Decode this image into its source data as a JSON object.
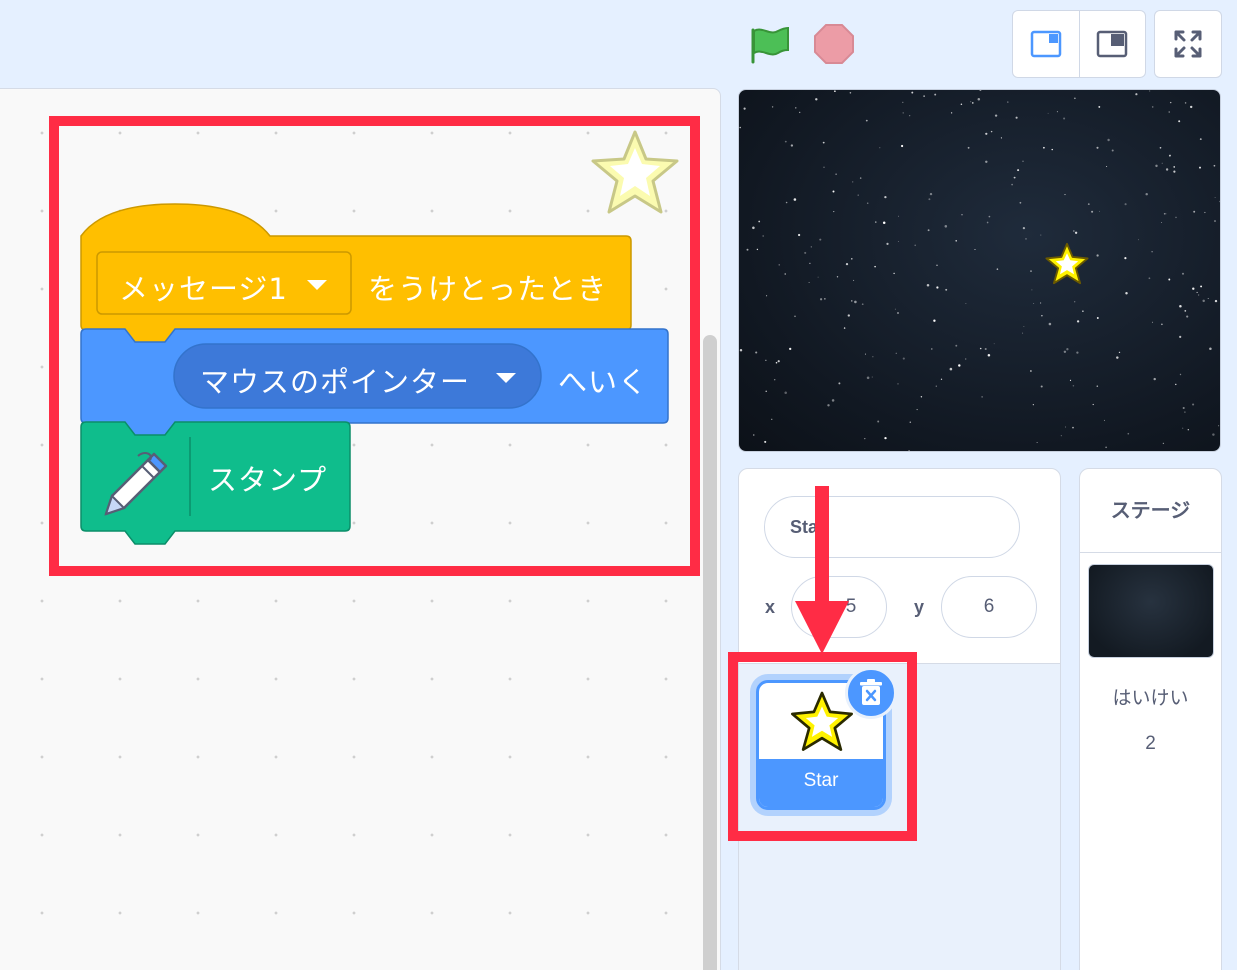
{
  "toolbar": {
    "green_flag_icon": "green-flag-icon",
    "stop_icon": "stop-sign-icon",
    "layout_small_stage_icon": "small-stage-layout-icon",
    "layout_large_stage_icon": "large-stage-layout-icon",
    "fullscreen_icon": "fullscreen-icon"
  },
  "script": {
    "hat_block": {
      "dropdown_value": "メッセージ1",
      "label": "をうけとったとき",
      "color": "#ffbf00"
    },
    "motion_block": {
      "dropdown_value": "マウスのポインター",
      "label": "へいく",
      "color": "#4c97ff"
    },
    "pen_block": {
      "label": "スタンプ",
      "icon": "pen-icon",
      "color": "#0fbd8c"
    }
  },
  "sprite_info": {
    "name": "Star",
    "name_visible": "Sta",
    "x_label": "x",
    "x_value": "5",
    "y_label": "y",
    "y_value": "6"
  },
  "sprite_list": {
    "items": [
      {
        "name": "Star",
        "selected": true
      }
    ]
  },
  "stage_pane": {
    "header": "ステージ",
    "backdrop_label": "はいけい",
    "backdrop_count": "2"
  },
  "annotations": {
    "highlight_color": "#ff2c45"
  }
}
